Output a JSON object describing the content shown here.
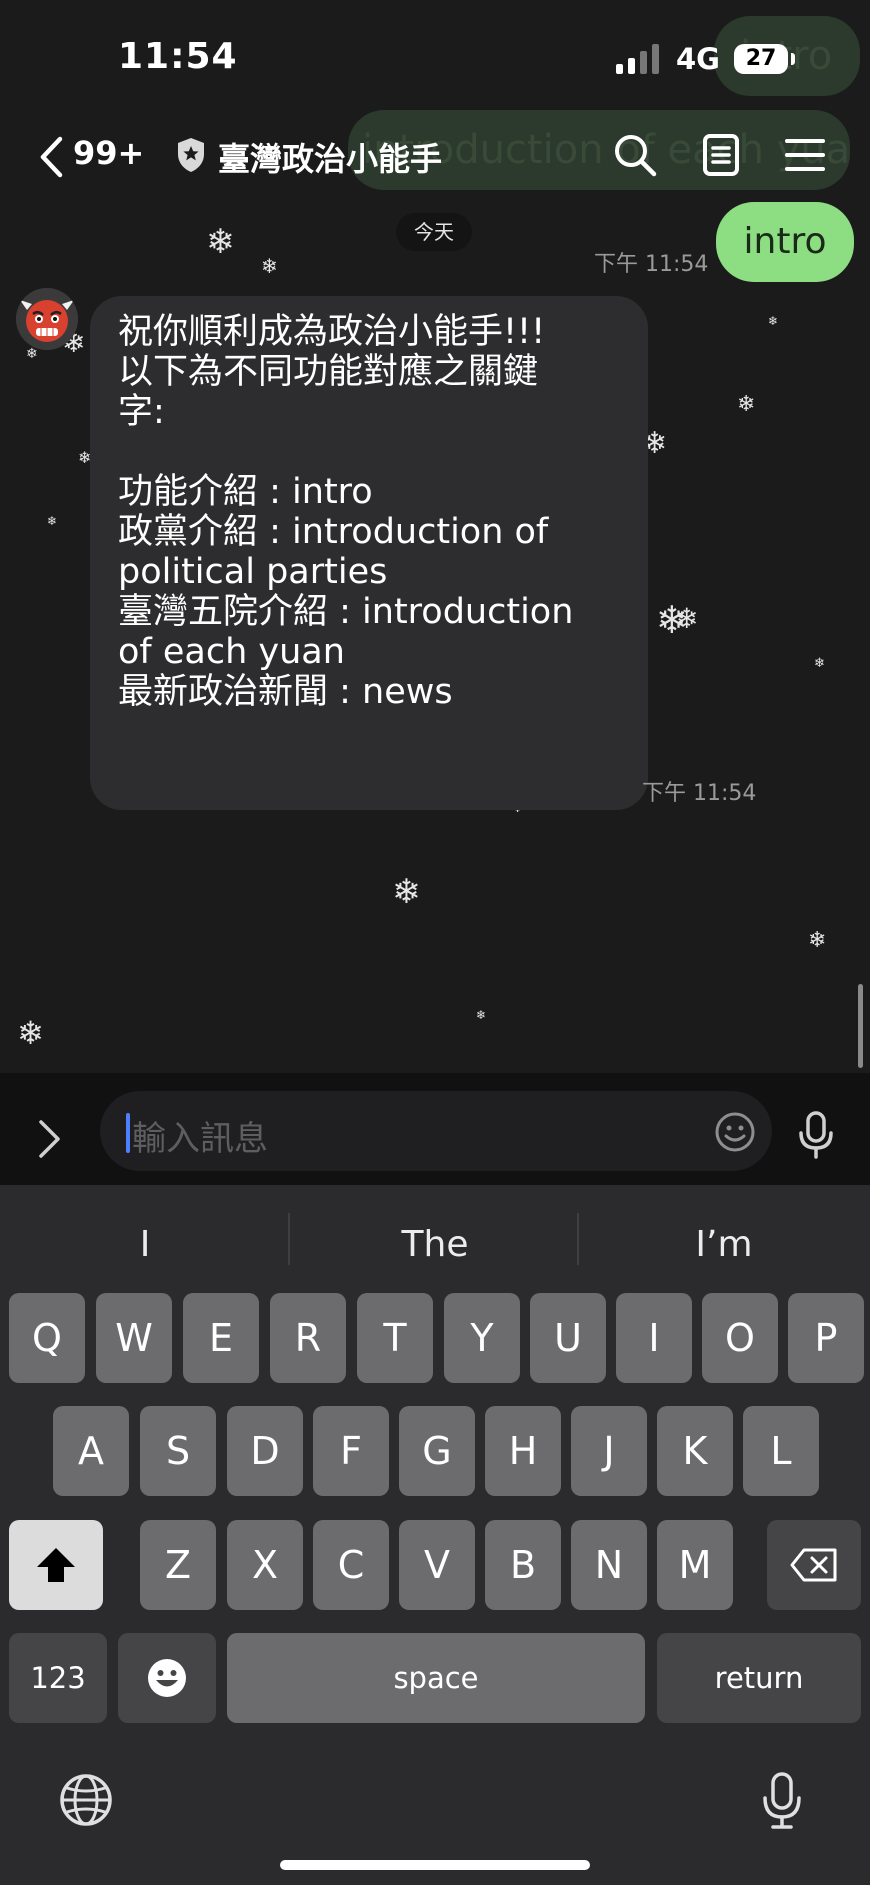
{
  "status_bar": {
    "time": "11:54",
    "network": "4G",
    "battery": "27"
  },
  "background_bubbles": [
    "intro",
    "introduction of each yuan"
  ],
  "header": {
    "unread_count": "99+",
    "title": "臺灣政治小能手",
    "icons": [
      "back-chevron-icon",
      "shield-star-icon",
      "search-icon",
      "note-icon",
      "menu-icon"
    ]
  },
  "chat": {
    "date_label": "今天",
    "messages": [
      {
        "direction": "out",
        "text": "intro",
        "time": "下午 11:54"
      },
      {
        "direction": "in",
        "lines": [
          "祝你順利成為政治小能手!!!",
          "以下為不同功能對應之關鍵",
          "字:",
          "",
          "功能介紹 : intro",
          "政黨介紹 : introduction of",
          "political parties",
          "臺灣五院介紹 : introduction",
          "of each yuan",
          "最新政治新聞 : news"
        ],
        "time": "下午 11:54"
      }
    ]
  },
  "input": {
    "placeholder": "輸入訊息",
    "icons": [
      "expand-chevron-icon",
      "emoji-icon",
      "microphone-icon"
    ]
  },
  "keyboard": {
    "suggestions": [
      "I",
      "The",
      "I’m"
    ],
    "row1": [
      "Q",
      "W",
      "E",
      "R",
      "T",
      "Y",
      "U",
      "I",
      "O",
      "P"
    ],
    "row2": [
      "A",
      "S",
      "D",
      "F",
      "G",
      "H",
      "J",
      "K",
      "L"
    ],
    "row3": [
      "Z",
      "X",
      "C",
      "V",
      "B",
      "N",
      "M"
    ],
    "numbers_label": "123",
    "space_label": "space",
    "return_label": "return",
    "icons": [
      "shift-icon",
      "delete-icon",
      "emoji-key-icon",
      "globe-icon",
      "dictation-mic-icon"
    ]
  }
}
